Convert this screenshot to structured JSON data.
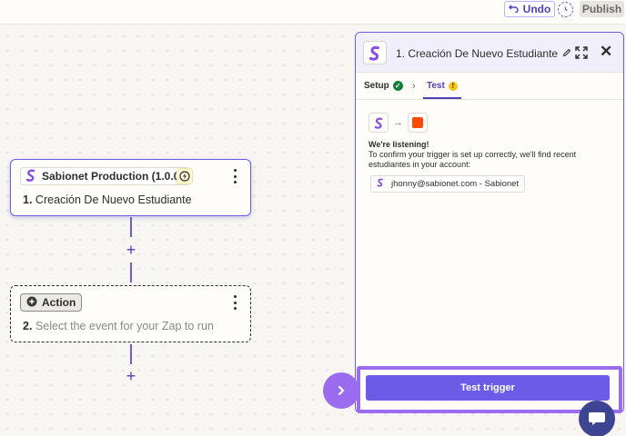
{
  "topbar": {
    "undo_label": "Undo",
    "publish_label": "Publish",
    "history_icon": "history-icon"
  },
  "trigger_step": {
    "app_name": "Sabionet Production (1.0.0)",
    "number": "1.",
    "title": "Creación De Nuevo Estudiante",
    "badge_icon": "bolt-icon"
  },
  "action_step": {
    "chip_label": "Action",
    "number": "2.",
    "placeholder": "Select the event for your Zap to run"
  },
  "panel": {
    "title": "1. Creación De Nuevo Estudiante",
    "tabs": [
      {
        "label": "Setup",
        "status": "complete"
      },
      {
        "label": "Test",
        "status": "warning",
        "active": true
      }
    ],
    "tab_separator": "›",
    "warning_glyph": "!",
    "listening_title": "We're listening!",
    "listening_text": "To confirm your trigger is set up correctly, we'll find recent estudiantes in your account:",
    "account": "jhonny@sabionet.com - Sabionet",
    "test_button_label": "Test trigger"
  },
  "colors": {
    "accent": "#6b5ce7",
    "accent_dark": "#503ebd",
    "highlight": "#9b6cf0",
    "zapier_orange": "#ff4a00",
    "chat": "#3d4592"
  }
}
